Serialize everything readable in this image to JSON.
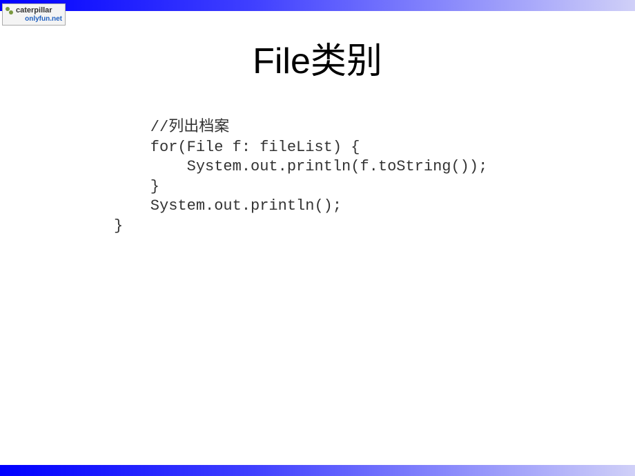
{
  "logo": {
    "line1": "caterpillar",
    "line2": "onlyfun.net"
  },
  "title": "File类别",
  "code": "    //列出档案\n    for(File f: fileList) {\n        System.out.println(f.toString());\n    }\n    System.out.println();\n}"
}
